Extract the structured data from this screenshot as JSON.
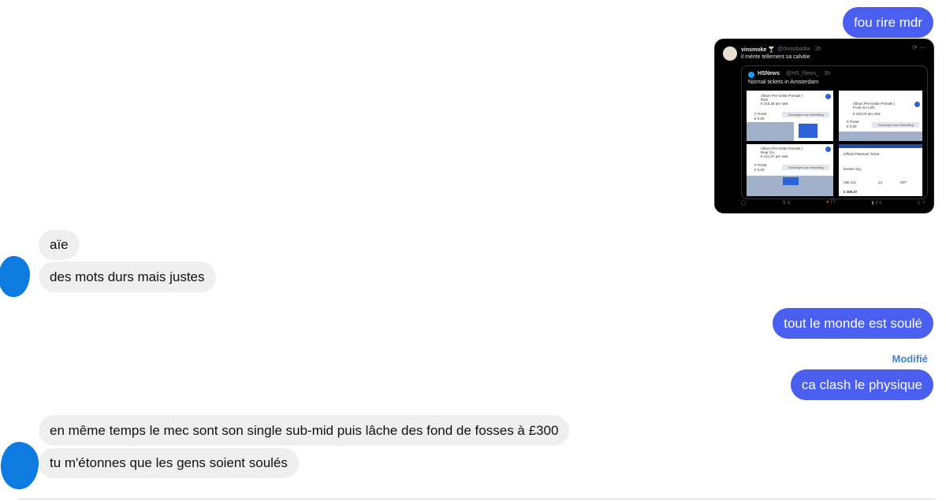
{
  "messages": [
    {
      "id": "m1",
      "side": "out",
      "text": "fou rire mdr"
    },
    {
      "id": "m2",
      "side": "out",
      "type": "image",
      "tweet": {
        "author": "vinsmoke 🍸",
        "handle": "@divasbadwi · 2h",
        "text": "il mérite tellement sa calvitie",
        "quote": {
          "author": "HSNews",
          "handle": "@HS_News_ · 3h",
          "text": "Normal tickets in Amsterdam",
          "panels": [
            {
              "title": "Album Pre-Order Presale | RSS",
              "price": "€ 315,26 per stuk",
              "count": "0 Ticket",
              "total": "€ 0,00",
              "button": "Toevoegen aan bestelling"
            },
            {
              "title": "Album Pre-Order Presale | Front GA Left",
              "price": "€ 184,24 per stuk",
              "count": "0 Ticket",
              "total": "€ 0,00",
              "button": "Toevoegen aan bestelling"
            },
            {
              "title": "Album Pre-Order Presale | Rear GA",
              "price": "€ 141,37 per stuk",
              "count": "0 Ticket",
              "total": "€ 0,00",
              "button": "Toevoegen aan bestelling"
            },
            {
              "title": "Official Platinum Ticket",
              "row_label": "Eerste ring",
              "col1": "Vak 121",
              "col2": "13",
              "col3": "207",
              "price": "€ 369,37"
            }
          ]
        },
        "stats": {
          "retweets": "8",
          "likes": "77",
          "views": "2 k"
        }
      }
    },
    {
      "id": "m3",
      "side": "in",
      "text": "aïe"
    },
    {
      "id": "m4",
      "side": "in",
      "text": "des mots durs mais justes"
    },
    {
      "id": "m5",
      "side": "out",
      "text": "tout le monde est soulé"
    },
    {
      "id": "m6",
      "side": "out",
      "text": "ca clash le physique",
      "edited_label": "Modifié"
    },
    {
      "id": "m7",
      "side": "in",
      "text": "en même temps le mec sont son single sub-mid puis lâche des fond de fosses à £300"
    },
    {
      "id": "m8",
      "side": "in",
      "text": "tu m'étonnes que les gens soient soulés"
    }
  ],
  "colors": {
    "outgoing_bubble": "#4a5ef0",
    "incoming_bubble": "#efefef",
    "avatar": "#0d7be0",
    "edited": "#3f82d8"
  }
}
